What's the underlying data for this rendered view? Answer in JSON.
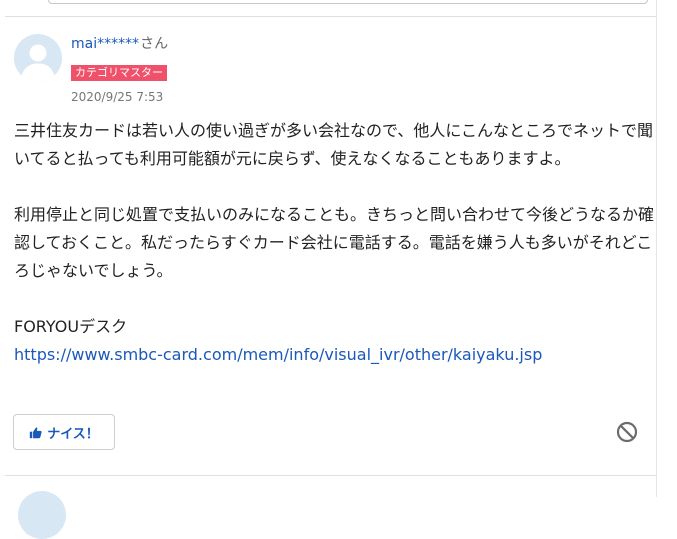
{
  "answer": {
    "username": "mai******",
    "honorific": "さん",
    "badge": "カテゴリマスター",
    "timestamp": "2020/9/25 7:53",
    "paragraphs": [
      "三井住友カードは若い人の使い過ぎが多い会社なので、他人にこんなところでネットで聞いてると払っても利用可能額が元に戻らず、使えなくなることもありますよ。",
      "利用停止と同じ処置で支払いのみになることも。きちっと問い合わせて今後どうなるか確認しておくこと。私だったらすぐカード会社に電話する。電話を嫌う人も多いがそれどころじゃないでしょう。",
      "FORYOUデスク"
    ],
    "link": "https://www.smbc-card.com/mem/info/visual_ivr/other/kaiyaku.jsp",
    "nice_label": "ナイス！"
  },
  "icons": {
    "avatar": "default-user-avatar",
    "nice": "thumbs-up-icon",
    "report": "prohibited-icon"
  },
  "colors": {
    "link": "#1a58ba",
    "badge": "#f0516a",
    "avatar_bg": "#d7e7f4",
    "avatar_figure": "#ffffff",
    "report_icon": "#6b6b6b"
  }
}
